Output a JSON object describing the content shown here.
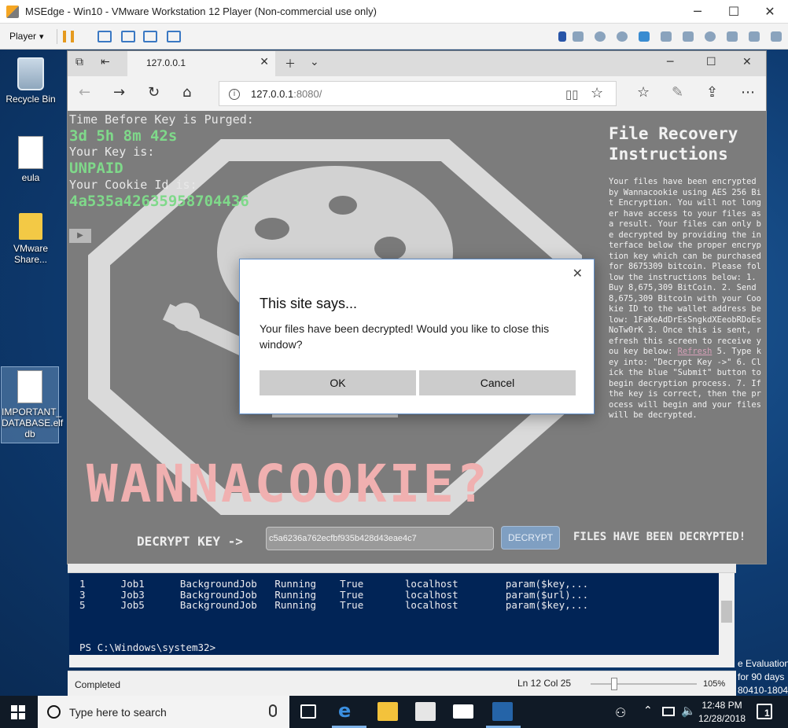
{
  "vm": {
    "title": "MSEdge - Win10 - VMware Workstation 12 Player (Non-commercial use only)",
    "player_menu": "Player"
  },
  "desktop": {
    "icons": [
      {
        "label": "Recycle Bin"
      },
      {
        "label": "eula"
      },
      {
        "label": "VMware Share..."
      },
      {
        "label": "IMPORTANT_ DATABASE.elf db"
      }
    ]
  },
  "edge": {
    "tab_title": "127.0.0.1",
    "url_host": "127.0.0.1",
    "url_rest": ":8080/"
  },
  "page": {
    "timer_label": "Time Before Key is Purged:",
    "timer_value": "3d 5h 8m 42s",
    "key_label": "Your Key is:",
    "key_value": "UNPAID",
    "cookie_label": "Your Cookie Id is:",
    "cookie_value": "4a535a42635958704436",
    "title_art": "WANNACOOKIE?",
    "decrypt_label": "DECRYPT KEY ->",
    "decrypt_input_value": "c5a6236a762ecfbf935b428d43eae4c7",
    "decrypt_button": "DECRYPT",
    "decrypted_status": "FILES HAVE BEEN DECRYPTED!",
    "instructions_title": "File Recovery Instructions",
    "instructions_before_link": " Your files have been encrypted by Wannacookie using AES 256 Bit Encryption. You will not longer have access to your files as a result. Your files can only be decrypted by providing the interface below the proper encryption key which can be purchased for 8675309 bitcoin. Please follow the instructions below: 1. Buy 8,675,309 BitCoin. 2. Send 8,675,309 Bitcoin with your Cookie ID to the wallet address below: 1FaKeAdDrEsSngkdXEeobRDoEsNoTw0rK 3. Once this is sent, refresh this screen to receive you key below: ",
    "refresh_link": "Refresh",
    "instructions_after_link": " 5. Type key into: \"Decrypt Key ->\" 6. Click the blue \"Submit\" button to begin decryption process. 7. If the key is correct, then the process will begin and your files will be decrypted."
  },
  "dialog": {
    "title": "This site says...",
    "message": "Your files have been decrypted! Would you like to close this window?",
    "ok": "OK",
    "cancel": "Cancel"
  },
  "powershell": {
    "rows": [
      "1      Job1      BackgroundJob   Running    True       localhost        param($key,...",
      "3      Job3      BackgroundJob   Running    True       localhost        param($url)...",
      "5      Job5      BackgroundJob   Running    True       localhost        param($key,..."
    ],
    "prompt": "PS C:\\Windows\\system32>",
    "status": "Completed",
    "lncol": "Ln 12  Col 25",
    "zoom": "105%",
    "zoom_level": 0.19
  },
  "watermark": {
    "line1": "e Evaluation",
    "line2": "for 90 days",
    "line3": "80410-1804"
  },
  "taskbar": {
    "search_placeholder": "Type here to search",
    "time": "12:48 PM",
    "date": "12/28/2018",
    "notification_count": "1"
  },
  "colors": {
    "console_bg": "#012456",
    "taskbar_bg": "#101a26",
    "accent_green": "#7fd98a"
  }
}
